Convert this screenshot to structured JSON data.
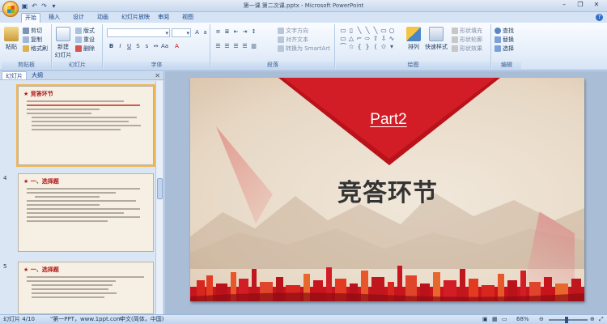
{
  "window": {
    "title": "第一课 第二次课.pptx - Microsoft PowerPoint",
    "qat_icons": [
      "save-icon",
      "undo-icon",
      "redo-icon",
      "customize-icon"
    ]
  },
  "tabs": [
    "开始",
    "插入",
    "设计",
    "动画",
    "幻灯片放映",
    "审阅",
    "视图"
  ],
  "active_tab": "开始",
  "ribbon": {
    "clipboard": {
      "label": "剪贴板",
      "paste": "粘贴",
      "cut": "剪切",
      "copy": "复制",
      "format_painter": "格式刷"
    },
    "slides": {
      "label": "幻灯片",
      "new_slide": "新建\n幻灯片",
      "layout": "版式",
      "reset": "重设",
      "delete": "删除"
    },
    "font": {
      "label": "字体",
      "font_name": "",
      "font_size": ""
    },
    "paragraph": {
      "label": "段落",
      "text_direction": "文字方向",
      "align_text": "对齐文本",
      "smartart": "转换为 SmartArt"
    },
    "drawing": {
      "label": "绘图",
      "arrange": "排列",
      "quick_styles": "快速样式",
      "shape_fill": "形状填充",
      "shape_outline": "形状轮廓",
      "shape_effects": "形状效果"
    },
    "editing": {
      "label": "编辑",
      "find": "查找",
      "replace": "替换",
      "select": "选择"
    }
  },
  "left_pane": {
    "tabs": [
      "幻灯片",
      "大纲"
    ],
    "slides": [
      {
        "number": "",
        "title": "竞答环节"
      },
      {
        "number": "4",
        "title": "一、选择题"
      },
      {
        "number": "5",
        "title": "一、选择题"
      }
    ]
  },
  "slide": {
    "part": "Part2",
    "title": "竞答环节"
  },
  "status": {
    "slide_info": "幻灯片 4/10",
    "theme": "\"第一PPT，www.1ppt.com\"",
    "language": "中文(简体，中国)",
    "zoom": "68%"
  },
  "colors": {
    "accent_red": "#b9121b",
    "ribbon_blue": "#d5e3f4"
  }
}
